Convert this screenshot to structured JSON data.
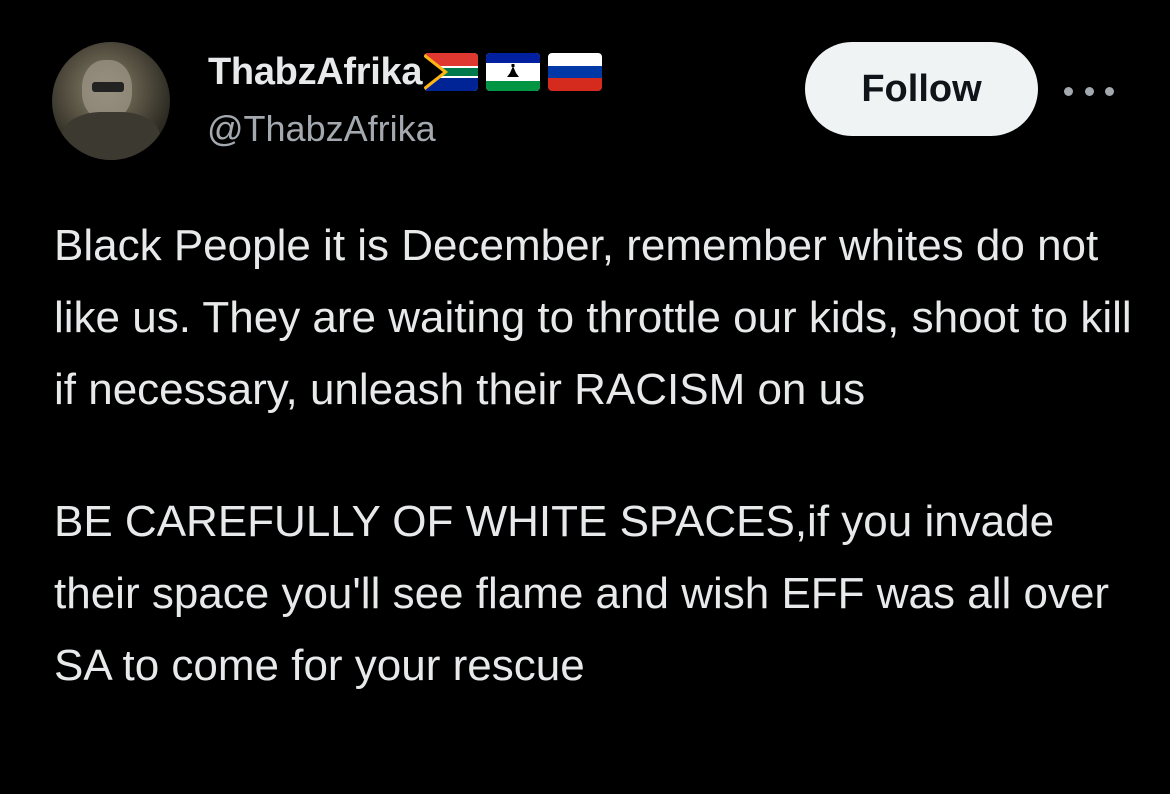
{
  "author": {
    "display_name": "ThabzAfrika",
    "handle": "@ThabzAfrika",
    "flags": [
      "south-africa-flag",
      "lesotho-flag",
      "russia-flag"
    ]
  },
  "actions": {
    "follow_label": "Follow"
  },
  "tweet": {
    "paragraph_1": "Black People it is December, remember whites do not like us. They are waiting to throttle our kids, shoot to kill if necessary, unleash their RACISM on us",
    "paragraph_2": "BE CAREFULLY OF WHITE SPACES,if you invade their space you'll see flame and wish EFF was all over SA to come for your rescue"
  },
  "colors": {
    "background": "#000000",
    "text_primary": "#e7e9ea",
    "text_secondary": "#a3a9ae",
    "button_bg": "#eff3f4",
    "button_text": "#0f1419"
  }
}
